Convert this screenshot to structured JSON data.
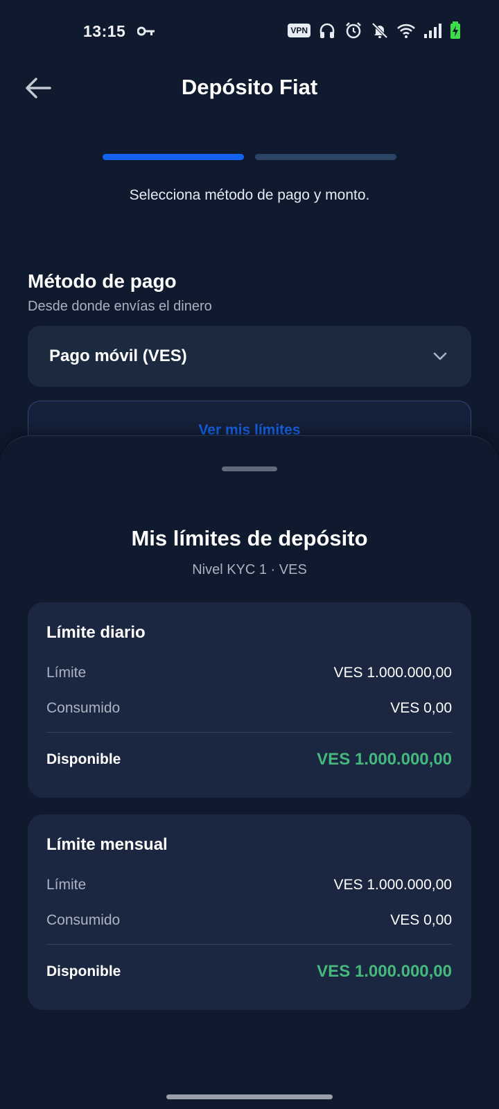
{
  "status_bar": {
    "time": "13:15",
    "vpn_label": "VPN",
    "icons": [
      "key-icon",
      "headphones-icon",
      "alarm-icon",
      "bell-off-icon",
      "wifi-icon",
      "signal-icon",
      "battery-charging-icon"
    ],
    "battery_color": "#3ddc4a"
  },
  "header": {
    "title": "Depósito Fiat"
  },
  "progress": {
    "steps_total": 2,
    "current_step": 1,
    "active_color": "#1463f0",
    "inactive_color": "#2b4466"
  },
  "step_description": "Selecciona método de pago y monto.",
  "payment_method": {
    "title": "Método de pago",
    "subtitle": "Desde donde envías el dinero",
    "selected": "Pago móvil (VES)"
  },
  "limits_button": {
    "label": "Ver mis límites"
  },
  "sheet": {
    "title": "Mis límites de depósito",
    "subtitle": "Nivel KYC 1 · VES",
    "cards": [
      {
        "title": "Límite diario",
        "limit_label": "Límite",
        "limit_value": "VES 1.000.000,00",
        "used_label": "Consumido",
        "used_value": "VES 0,00",
        "available_label": "Disponible",
        "available_value": "VES 1.000.000,00"
      },
      {
        "title": "Límite mensual",
        "limit_label": "Límite",
        "limit_value": "VES 1.000.000,00",
        "used_label": "Consumido",
        "used_value": "VES 0,00",
        "available_label": "Disponible",
        "available_value": "VES 1.000.000,00"
      }
    ]
  },
  "colors": {
    "background": "#0f1a2e",
    "accent": "#1666f0",
    "available_green": "#45b97c"
  }
}
